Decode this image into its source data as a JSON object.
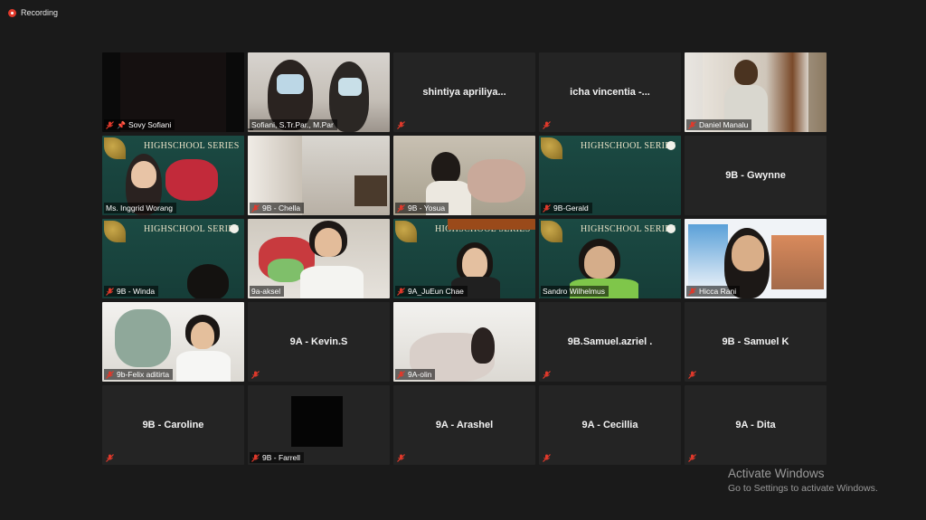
{
  "recording": {
    "label": "Recording"
  },
  "tiles": [
    {
      "name": "Sovy Sofiani",
      "pinned": true,
      "muted": true,
      "video": true
    },
    {
      "name": "Sofiani, S.Tr.Par., M.Par",
      "muted": true,
      "video": true
    },
    {
      "name": "shintiya apriliya...",
      "muted": true,
      "video": false
    },
    {
      "name": "icha vincentia -...",
      "muted": true,
      "video": false
    },
    {
      "name": "Daniel Manalu",
      "muted": true,
      "video": true
    },
    {
      "name": "Ms. Inggrid Worang",
      "muted": false,
      "video": true
    },
    {
      "name": "9B - Chella",
      "muted": true,
      "video": true
    },
    {
      "name": "9B - Yosua",
      "muted": true,
      "video": true
    },
    {
      "name": "9B-Gerald",
      "muted": true,
      "video": true
    },
    {
      "name": "9B - Gwynne",
      "muted": false,
      "video": false
    },
    {
      "name": "9B - Winda",
      "muted": true,
      "video": true
    },
    {
      "name": "9a-aksel",
      "muted": false,
      "video": true
    },
    {
      "name": "9A_JuEun Chae",
      "muted": true,
      "video": true
    },
    {
      "name": "Sandro Wilhelmus",
      "muted": false,
      "video": true,
      "speaking": true
    },
    {
      "name": "Hicca Rani",
      "muted": true,
      "video": true
    },
    {
      "name": "9b-Felix aditirta",
      "muted": true,
      "video": true
    },
    {
      "name": "9A - Kevin.S",
      "muted": true,
      "video": false
    },
    {
      "name": "9A-olin",
      "muted": true,
      "video": true
    },
    {
      "name": "9B.Samuel.azriel .",
      "muted": true,
      "video": false
    },
    {
      "name": "9B - Samuel K",
      "muted": true,
      "video": false
    },
    {
      "name": "9B - Caroline",
      "muted": true,
      "video": false
    },
    {
      "name": "9B - Farrell",
      "muted": true,
      "video": true
    },
    {
      "name": "9A - Arashel",
      "muted": true,
      "video": false
    },
    {
      "name": "9A - Cecillia",
      "muted": true,
      "video": false
    },
    {
      "name": "9A - Dita",
      "muted": true,
      "video": false
    }
  ],
  "slide_title": "HIGHSCHOOL SERIES",
  "watermark": {
    "line1": "Activate Windows",
    "line2": "Go to Settings to activate Windows."
  },
  "colors": {
    "speaking_border": "#c7d53a",
    "muted_icon": "#e0392b",
    "tile_bg": "#242424"
  }
}
